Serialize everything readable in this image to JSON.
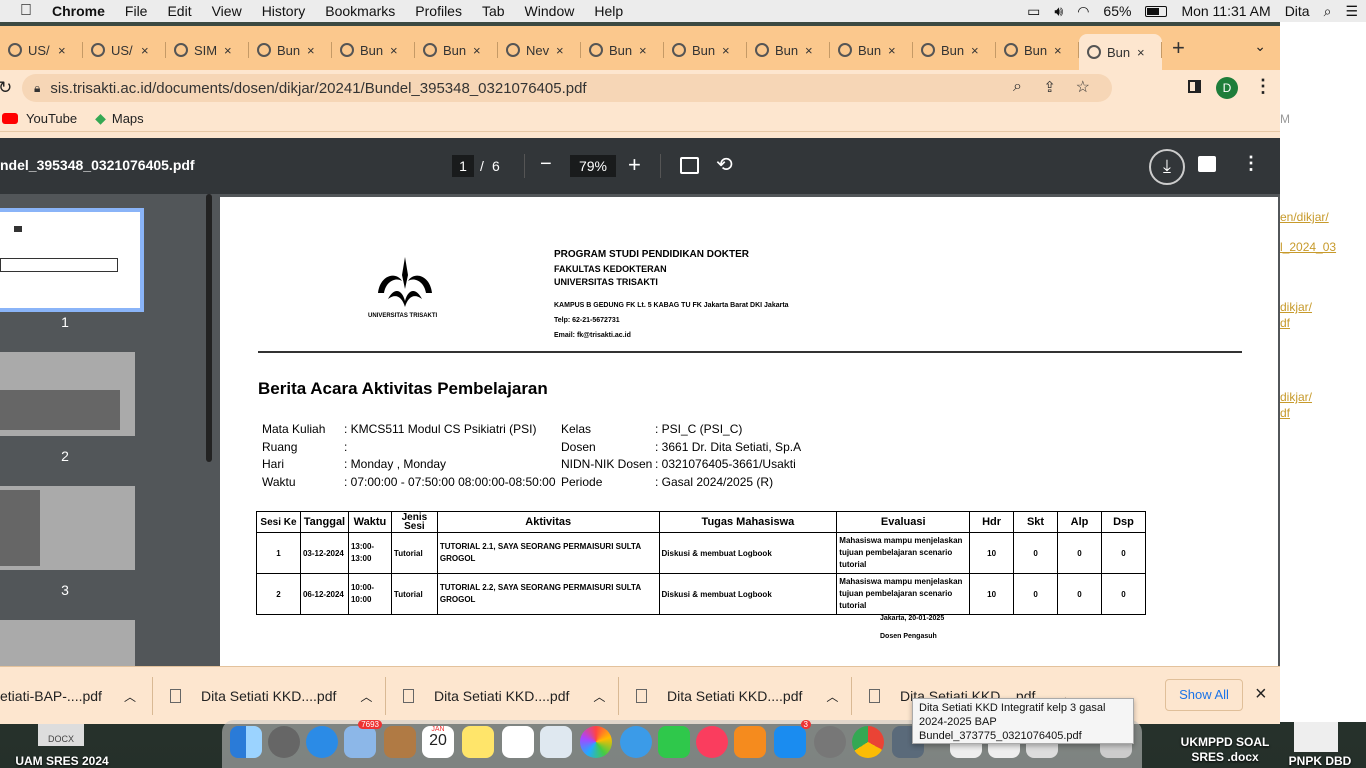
{
  "menubar": {
    "apple": "",
    "items": [
      "Chrome",
      "File",
      "Edit",
      "View",
      "History",
      "Bookmarks",
      "Profiles",
      "Tab",
      "Window",
      "Help"
    ],
    "battery": "65%",
    "clock": "Mon 11:31 AM",
    "user": "Dita"
  },
  "tabs": [
    {
      "title": "US/"
    },
    {
      "title": "US/"
    },
    {
      "title": "SIM"
    },
    {
      "title": "Bun"
    },
    {
      "title": "Bun"
    },
    {
      "title": "Bun"
    },
    {
      "title": "Nev"
    },
    {
      "title": "Bun"
    },
    {
      "title": "Bun"
    },
    {
      "title": "Bun"
    },
    {
      "title": "Bun"
    },
    {
      "title": "Bun"
    },
    {
      "title": "Bun"
    },
    {
      "title": "Bun"
    }
  ],
  "tab_close": "×",
  "new_tab": "+",
  "address": {
    "url": "sis.trisakti.ac.id/documents/dosen/dikjar/20241/Bundel_395348_0321076405.pdf"
  },
  "profile_initial": "D",
  "bookmarks": [
    {
      "label": "YouTube"
    },
    {
      "label": "Maps"
    }
  ],
  "pdf": {
    "filename": "ndel_395348_0321076405.pdf",
    "page_current": "1",
    "page_sep": "/",
    "page_total": "6",
    "zoom": "79%",
    "zoom_minus": "−",
    "zoom_plus": "+"
  },
  "thumbs": [
    "1",
    "2",
    "3"
  ],
  "doc": {
    "logo_text": "UNIVERSITAS TRISAKTI",
    "h1": "PROGRAM STUDI PENDIDIKAN DOKTER",
    "h2": "FAKULTAS KEDOKTERAN",
    "h3": "UNIVERSITAS TRISAKTI",
    "addr": "KAMPUS B GEDUNG FK Lt. 5 KABAG TU FK Jakarta Barat DKI Jakarta",
    "telp": "Telp: 62-21-5672731",
    "email": "Email: fk@trisakti.ac.id",
    "title": "Berita Acara Aktivitas Pembelajaran",
    "fields_left": [
      {
        "k": "Mata Kuliah",
        "v": ": KMCS511  Modul CS Psikiatri (PSI)"
      },
      {
        "k": "Ruang",
        "v": ":"
      },
      {
        "k": "Hari",
        "v": ": Monday , Monday"
      },
      {
        "k": "Waktu",
        "v": ": 07:00:00 - 07:50:00 08:00:00-08:50:00"
      }
    ],
    "fields_right": [
      {
        "k": "Kelas",
        "v": ": PSI_C (PSI_C)"
      },
      {
        "k": "Dosen",
        "v": ": 3661 Dr. Dita Setiati, Sp.A"
      },
      {
        "k": "NIDN-NIK Dosen",
        "v": ": 0321076405-3661/Usakti"
      },
      {
        "k": "Periode",
        "v": ": Gasal 2024/2025 (R)"
      }
    ],
    "table_headers": [
      "Sesi Ke",
      "Tanggal",
      "Waktu",
      "Jenis Sesi",
      "Aktivitas",
      "Tugas Mahasiswa",
      "Evaluasi",
      "Hdr",
      "Skt",
      "Alp",
      "Dsp"
    ],
    "rows": [
      {
        "sesi": "1",
        "tanggal": "03-12-2024",
        "waktu": "13:00-\n13:00",
        "jenis": "Tutorial",
        "aktivitas": "TUTORIAL 2.1, SAYA SEORANG PERMAISURI SULTA GROGOL",
        "tugas": "Diskusi & membuat Logbook",
        "evaluasi": "Mahasiswa mampu menjelaskan tujuan pembelajaran scenario tutorial",
        "hdr": "10",
        "skt": "0",
        "alp": "0",
        "dsp": "0"
      },
      {
        "sesi": "2",
        "tanggal": "06-12-2024",
        "waktu": "10:00-\n10:00",
        "jenis": "Tutorial",
        "aktivitas": "TUTORIAL 2.2, SAYA SEORANG PERMAISURI SULTA GROGOL",
        "tugas": "Diskusi & membuat Logbook",
        "evaluasi": "Mahasiswa mampu menjelaskan tujuan pembelajaran scenario tutorial",
        "hdr": "10",
        "skt": "0",
        "alp": "0",
        "dsp": "0"
      }
    ],
    "place_date": "Jakarta, 20-01-2025",
    "signer": "Dosen Pengasuh"
  },
  "downloads": {
    "items": [
      "etiati-BAP-....pdf",
      "Dita Setiati KKD....pdf",
      "Dita Setiati KKD....pdf",
      "Dita Setiati KKD....pdf",
      "Dita Setiati KKD....pdf"
    ],
    "show_all": "Show All",
    "close": "×"
  },
  "tooltip": "Dita Setiati KKD Integratif  kelp 3 gasal\n2024-2025 BAP\nBundel_373775_0321076405.pdf",
  "desktop_right": [
    {
      "text": "M"
    },
    {
      "text": "en/dikjar/"
    },
    {
      "text": "l_2024_03"
    },
    {
      "text": "dikjar/"
    },
    {
      "text": "df"
    },
    {
      "text": "dikjar/"
    },
    {
      "text": "df"
    }
  ],
  "desktop_labels": {
    "docx": "DOCX",
    "left": "UAM SRES  2024",
    "mid": "UKMPPD SOAL\nSRES .docx",
    "right": "PNPK DBD"
  },
  "dock_badges": {
    "photos": "7693",
    "calendar_month": "JAN",
    "calendar_day": "20",
    "appstore": "3"
  }
}
